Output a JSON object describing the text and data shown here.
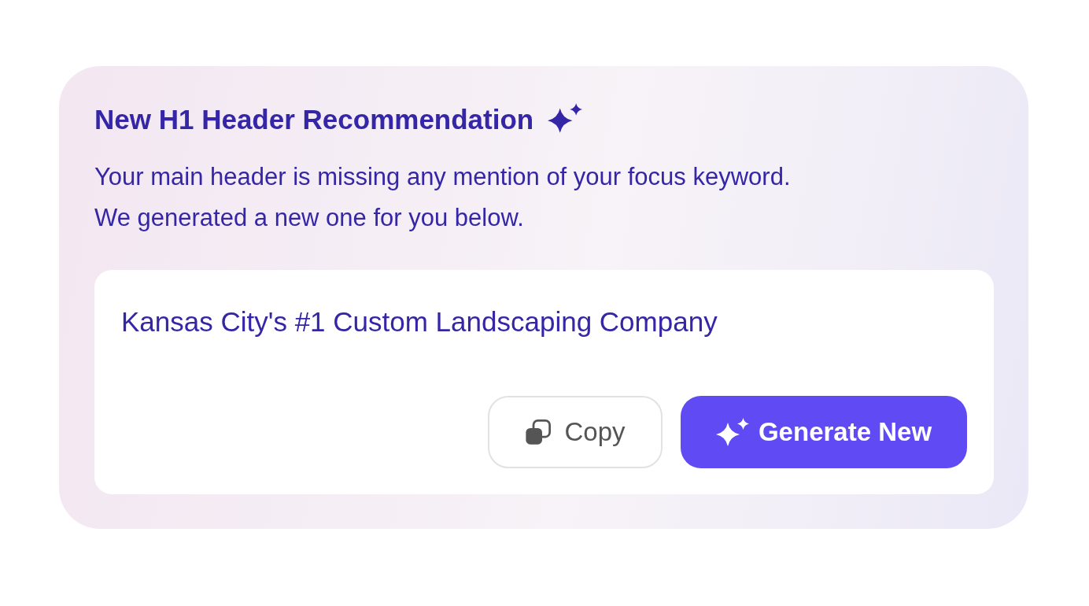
{
  "card": {
    "title": "New H1 Header Recommendation",
    "description": "Your main header is missing any mention of your focus keyword.\nWe generated a new one for you below.",
    "recommendation": {
      "text": "Kansas City's #1 Custom Landscaping Company",
      "buttons": [
        {
          "label": "Copy",
          "kind": "secondary"
        },
        {
          "label": "Generate New",
          "kind": "primary"
        }
      ]
    }
  }
}
